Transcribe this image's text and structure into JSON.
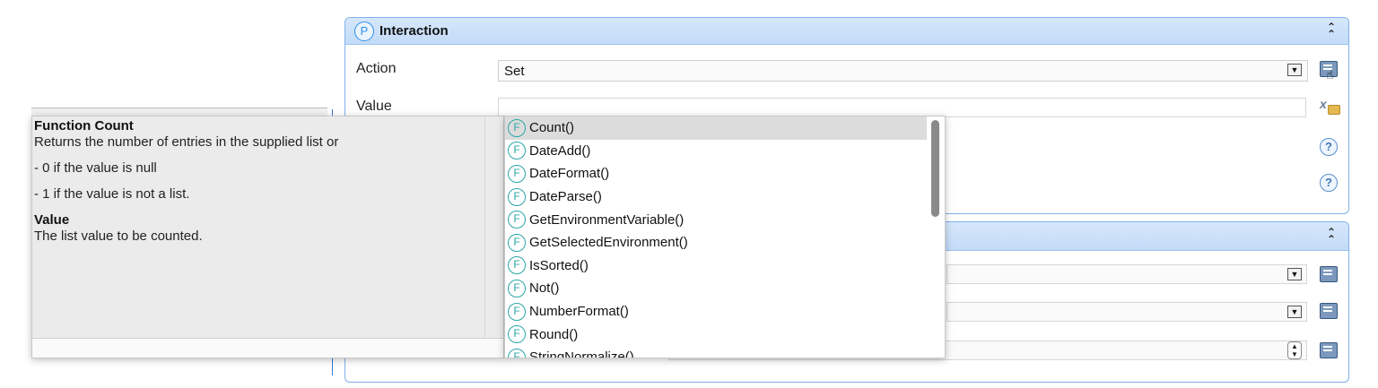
{
  "interaction_panel": {
    "title": "Interaction",
    "header_icon_glyph": "P",
    "action_label": "Action",
    "action_value": "Set",
    "value_label": "Value",
    "value_text": ""
  },
  "second_panel": {
    "title": ""
  },
  "tooltip": {
    "heading": "Function Count",
    "description": "Returns the number of entries in the supplied list or",
    "bullet_1": "- 0 if the value is null",
    "bullet_2": "- 1 if the value is not a list.",
    "param_heading": "Value",
    "param_description": "The list value to be counted."
  },
  "function_list": {
    "icon_glyph": "F",
    "items": [
      "Count()",
      "DateAdd()",
      "DateFormat()",
      "DateParse()",
      "GetEnvironmentVariable()",
      "GetSelectedEnvironment()",
      "IsSorted()",
      "Not()",
      "NumberFormat()",
      "Round()",
      "StringNormalize()"
    ],
    "selected_index": 0
  },
  "icons": {
    "collapse": "double-chevron-up-icon",
    "dropdown": "dropdown-arrow-icon",
    "help": "help-icon",
    "edit": "edit-list-icon",
    "formula": "formula-editor-icon"
  },
  "colors": {
    "panel_border": "#7fb0ea",
    "panel_header": "#c9def8",
    "function_icon": "#2aa6a6",
    "selected_row": "#dcdcdc",
    "tooltip_bg": "#ebebeb"
  }
}
